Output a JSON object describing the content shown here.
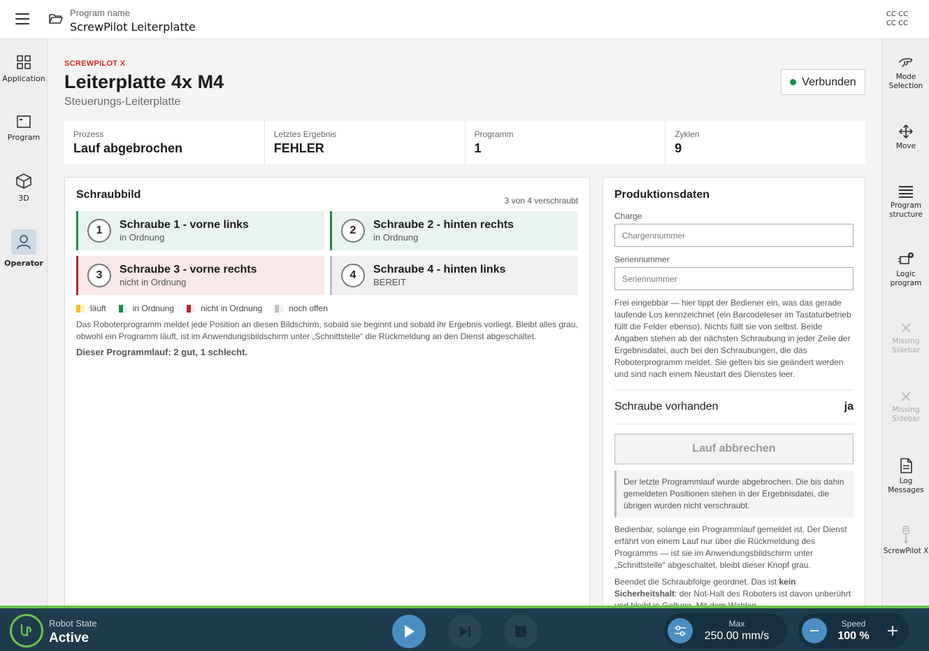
{
  "topbar": {
    "program_label": "Program name",
    "program_name": "ScrewPilot Leiterplatte",
    "cc_line1": "CC CC",
    "cc_line2": "CC CC"
  },
  "leftnav": {
    "items": [
      {
        "label": "Application",
        "icon": "grid-icon"
      },
      {
        "label": "Program",
        "icon": "window-icon"
      },
      {
        "label": "3D",
        "icon": "cube-icon"
      },
      {
        "label": "Operator",
        "icon": "user-icon",
        "active": true
      }
    ]
  },
  "rightnav": {
    "items": [
      {
        "label": "Mode Selection",
        "icon": "hand-icon"
      },
      {
        "label": "Move",
        "icon": "move-icon"
      },
      {
        "label": "Program structure",
        "icon": "list-icon"
      },
      {
        "label": "Logic program",
        "icon": "logic-icon"
      },
      {
        "label": "Missing Sidebar",
        "icon": "close-icon",
        "disabled": true
      },
      {
        "label": "Missing Sidebar",
        "icon": "close-icon",
        "disabled": true
      },
      {
        "label": "Log Messages",
        "icon": "document-icon"
      },
      {
        "label": "ScrewPilot X",
        "icon": "screwdriver-icon"
      }
    ]
  },
  "header": {
    "brand": "SCREWPILOT X",
    "title": "Leiterplatte 4x M4",
    "subtitle": "Steuerungs-Leiterplatte",
    "connection": "Verbunden",
    "connection_color": "#1e8a4c"
  },
  "stats": [
    {
      "label": "Prozess",
      "value": "Lauf abgebrochen"
    },
    {
      "label": "Letztes Ergebnis",
      "value": "FEHLER"
    },
    {
      "label": "Programm",
      "value": "1"
    },
    {
      "label": "Zyklen",
      "value": "9"
    }
  ],
  "schraubbild": {
    "title": "Schraubbild",
    "count": "3 von 4 verschraubt",
    "screws": [
      {
        "num": "1",
        "title": "Schraube 1 - vorne links",
        "status": "in Ordnung",
        "state": "ok"
      },
      {
        "num": "2",
        "title": "Schraube 2 - hinten rechts",
        "status": "in Ordnung",
        "state": "ok"
      },
      {
        "num": "3",
        "title": "Schraube 3 - vorne rechts",
        "status": "nicht in Ordnung",
        "state": "nok"
      },
      {
        "num": "4",
        "title": "Schraube 4 - hinten links",
        "status": "BEREIT",
        "state": "open"
      }
    ],
    "legend": [
      {
        "label": "läuft",
        "color": "#f2c21b"
      },
      {
        "label": "in Ordnung",
        "color": "#1e8a4c"
      },
      {
        "label": "nicht in Ordnung",
        "color": "#b02a2a"
      },
      {
        "label": "noch offen",
        "color": "#b8bec6"
      }
    ],
    "description": "Das Roboterprogramm meldet jede Position an diesen Bildschirm, sobald sie beginnt und sobald ihr Ergebnis vorliegt. Bleibt alles grau, obwohl ein Programm läuft, ist im Anwendungsbildschirm unter „Schnittstelle“ die Rückmeldung an den Dienst abgeschaltet.",
    "summary": "Dieser Programmlauf: 2 gut, 1 schlecht."
  },
  "produktion": {
    "title": "Produktionsdaten",
    "charge_label": "Charge",
    "charge_placeholder": "Chargennummer",
    "charge_value": "",
    "serial_label": "Seriennummer",
    "serial_placeholder": "Seriennummer",
    "serial_value": "",
    "help": "Frei eingebbar — hier tippt der Bediener ein, was das gerade laufende Los kennzeichnet (ein Barcodeleser im Tastaturbetrieb füllt die Felder ebenso). Nichts füllt sie von selbst. Beide Angaben stehen ab der nächsten Schraubung in jeder Zeile der Ergebnisdatei, auch bei den Schraubungen, die das Roboterprogramm meldet. Sie gelten bis sie geändert werden und sind nach einem Neustart des Dienstes leer.",
    "screw_present_label": "Schraube vorhanden",
    "screw_present_value": "ja",
    "abort_label": "Lauf abbrechen",
    "note": "Der letzte Programmlauf wurde abgebrochen. Die bis dahin gemeldeten Positionen stehen in der Ergebnisdatei, die übrigen wurden nicht verschraubt.",
    "help2": "Bedienbar, solange ein Programmlauf gemeldet ist. Der Dienst erfährt von einem Lauf nur über die Rückmeldung des Programms — ist sie im Anwendungsbildschirm unter „Schnittstelle“ abgeschaltet, bleibt dieser Knopf grau.",
    "help3_prefix": "Beendet die Schraubfolge geordnet. Das ist ",
    "help3_bold": "kein Sicherheitshalt",
    "help3_suffix": ": der Not-Halt des Roboters ist davon unberührt und bleibt in Geltung. Mit dem Wahlen"
  },
  "bottombar": {
    "robot_state_label": "Robot State",
    "robot_state_value": "Active",
    "max_label": "Max",
    "max_value": "250.00 mm/s",
    "speed_label": "Speed",
    "speed_value": "100 %"
  }
}
